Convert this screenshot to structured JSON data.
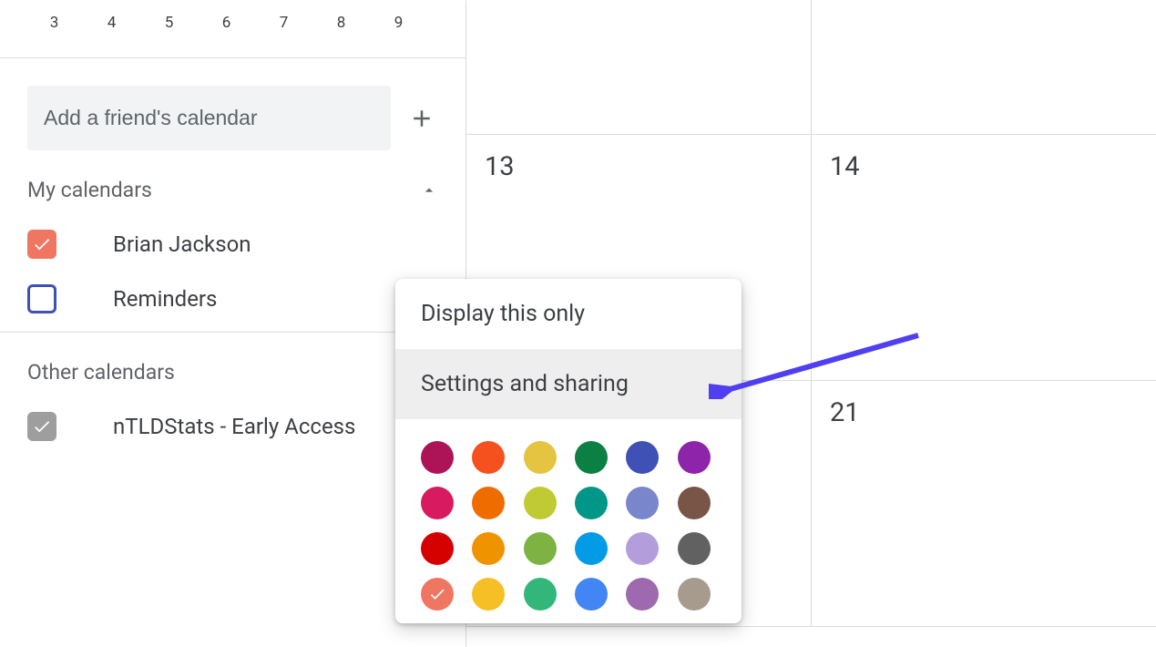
{
  "mini_calendar": {
    "days": [
      "3",
      "4",
      "5",
      "6",
      "7",
      "8",
      "9"
    ]
  },
  "add_friend": {
    "placeholder": "Add a friend's calendar"
  },
  "my_calendars": {
    "title": "My calendars",
    "items": [
      {
        "label": "Brian Jackson",
        "checked": true,
        "color": "#ef7762"
      },
      {
        "label": "Reminders",
        "checked": false,
        "color": "#3f51b5"
      }
    ]
  },
  "other_calendars": {
    "title": "Other calendars",
    "items": [
      {
        "label": "nTLDStats - Early Access",
        "checked": true,
        "color": "#9e9e9e"
      }
    ]
  },
  "grid": {
    "row2": [
      "13",
      "14"
    ],
    "row3": [
      "",
      "21"
    ]
  },
  "popup": {
    "display_only": "Display this only",
    "settings_sharing": "Settings and sharing",
    "colors": [
      {
        "hex": "#ad1457"
      },
      {
        "hex": "#f4511e"
      },
      {
        "hex": "#e4c441"
      },
      {
        "hex": "#0b8043"
      },
      {
        "hex": "#3f51b5"
      },
      {
        "hex": "#8e24aa"
      },
      {
        "hex": "#d81b60"
      },
      {
        "hex": "#ef6c00"
      },
      {
        "hex": "#c0ca33"
      },
      {
        "hex": "#009688"
      },
      {
        "hex": "#7986cb"
      },
      {
        "hex": "#795548"
      },
      {
        "hex": "#d50000"
      },
      {
        "hex": "#f09300"
      },
      {
        "hex": "#7cb342"
      },
      {
        "hex": "#039be5"
      },
      {
        "hex": "#b39ddb"
      },
      {
        "hex": "#616161"
      },
      {
        "hex": "#ef7762",
        "selected": true
      },
      {
        "hex": "#f6bf26"
      },
      {
        "hex": "#33b679"
      },
      {
        "hex": "#4285f4"
      },
      {
        "hex": "#9e69af"
      },
      {
        "hex": "#a79b8e"
      }
    ]
  }
}
